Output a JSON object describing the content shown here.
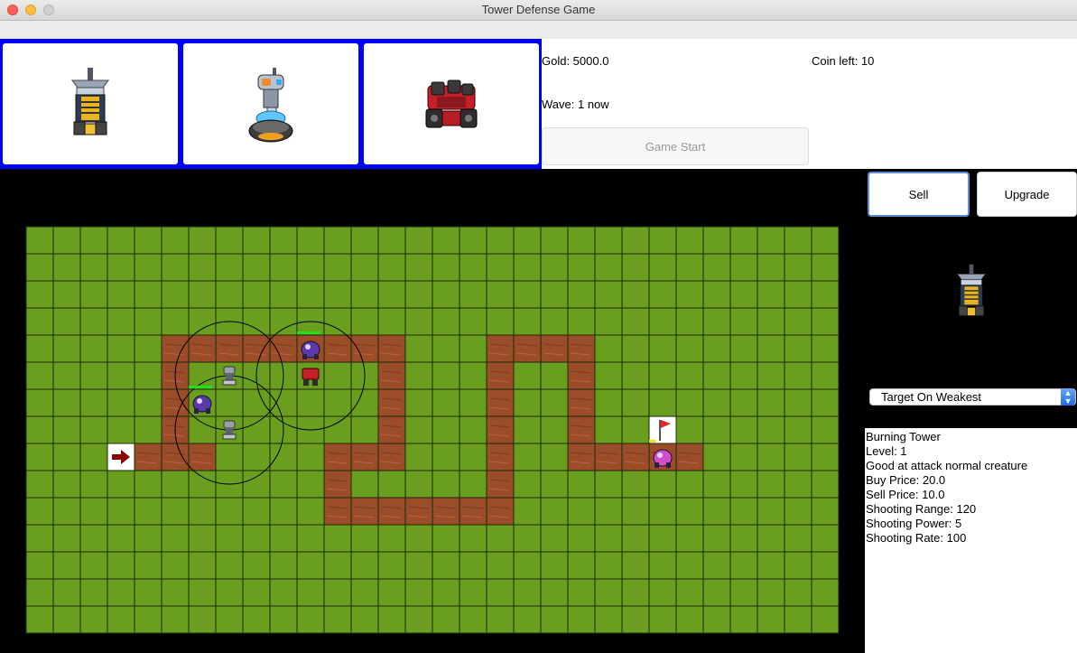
{
  "window": {
    "title": "Tower Defense Game"
  },
  "shop": {
    "towers": [
      {
        "name": "yellow-tower",
        "icon": "yellow-drill-tower-icon"
      },
      {
        "name": "blue-tower",
        "icon": "blue-dome-tower-icon"
      },
      {
        "name": "red-tower",
        "icon": "red-cannon-tower-icon"
      }
    ],
    "border_color": "#0000ff"
  },
  "status": {
    "gold": "Gold: 5000.0",
    "coins": "Coin left: 10",
    "wave": "Wave: 1 now",
    "start_button": "Game Start"
  },
  "controls": {
    "sell_button": "Sell",
    "upgrade_button": "Upgrade",
    "target_select": "Target On Weakest"
  },
  "selected_tower": {
    "icon": "yellow-drill-tower-icon",
    "lines": [
      "Burning Tower",
      "Level: 1",
      "Good at attack normal creature",
      "Buy Price: 20.0",
      "Sell Price: 10.0",
      "Shooting Range: 120",
      "Shooting Power: 5",
      "Shooting Rate: 100"
    ]
  },
  "map": {
    "cols": 30,
    "rows": 15,
    "grass_color": "#6a9e1f",
    "path_color": "#9b4d2a",
    "start_icon": "arrow-right-icon",
    "goal_icon": "flag-icon",
    "path_cells": [
      [
        5,
        4
      ],
      [
        6,
        4
      ],
      [
        7,
        4
      ],
      [
        8,
        4
      ],
      [
        9,
        4
      ],
      [
        10,
        4
      ],
      [
        11,
        4
      ],
      [
        12,
        4
      ],
      [
        13,
        4
      ],
      [
        5,
        5
      ],
      [
        13,
        5
      ],
      [
        5,
        6
      ],
      [
        13,
        6
      ],
      [
        5,
        7
      ],
      [
        13,
        7
      ],
      [
        5,
        8
      ],
      [
        6,
        8
      ],
      [
        13,
        8
      ],
      [
        11,
        8
      ],
      [
        12,
        8
      ],
      [
        11,
        9
      ],
      [
        11,
        10
      ],
      [
        12,
        10
      ],
      [
        13,
        10
      ],
      [
        14,
        10
      ],
      [
        15,
        10
      ],
      [
        16,
        10
      ],
      [
        17,
        10
      ],
      [
        17,
        4
      ],
      [
        18,
        4
      ],
      [
        19,
        4
      ],
      [
        20,
        4
      ],
      [
        17,
        5
      ],
      [
        20,
        5
      ],
      [
        17,
        6
      ],
      [
        20,
        6
      ],
      [
        17,
        7
      ],
      [
        20,
        7
      ],
      [
        17,
        8
      ],
      [
        17,
        9
      ],
      [
        20,
        8
      ],
      [
        21,
        8
      ],
      [
        22,
        8
      ],
      [
        23,
        8
      ],
      [
        24,
        8
      ]
    ],
    "extra_path": [
      [
        4,
        8
      ]
    ],
    "start_cell": [
      3,
      8
    ],
    "goal_cell": [
      23,
      7
    ],
    "towers": [
      {
        "cell": [
          7,
          5
        ],
        "type": "grey-mech-tower-icon"
      },
      {
        "cell": [
          7,
          7
        ],
        "type": "grey-mech-tower-icon"
      },
      {
        "cell": [
          10,
          5
        ],
        "type": "red-cannon-tower-icon"
      }
    ],
    "creatures": [
      {
        "cell": [
          10,
          4
        ],
        "type": "purple-creature-icon",
        "health": 1.0
      },
      {
        "cell": [
          6,
          6
        ],
        "type": "purple-creature-icon",
        "health": 1.0
      },
      {
        "cell": [
          23,
          8
        ],
        "type": "pink-creature-icon",
        "health": 0.3
      }
    ],
    "ranges": [
      {
        "cell": [
          7,
          5
        ]
      },
      {
        "cell": [
          7,
          7
        ]
      },
      {
        "cell": [
          10,
          5
        ]
      }
    ]
  }
}
